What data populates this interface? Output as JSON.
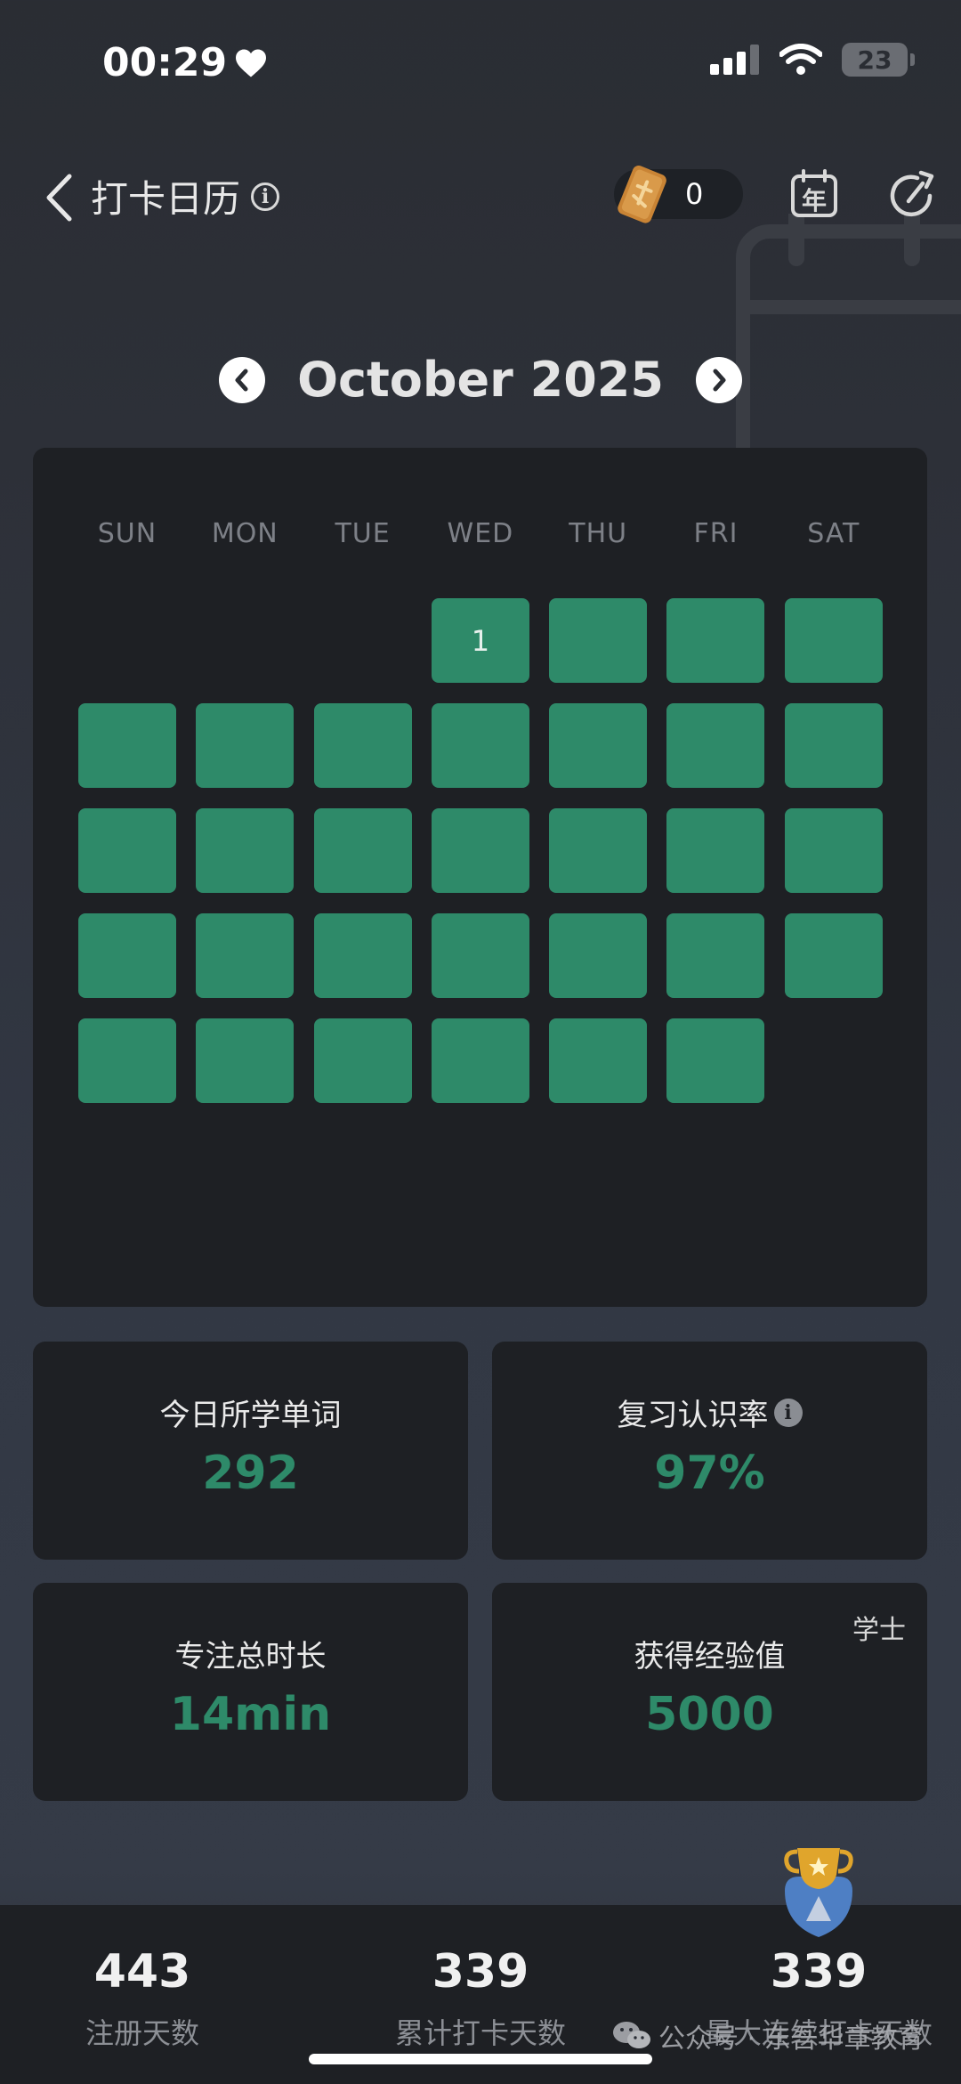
{
  "status_bar": {
    "time": "00:29",
    "battery": "23"
  },
  "header": {
    "title": "打卡日历",
    "coins": "0",
    "year_button": "年"
  },
  "calendar": {
    "month_label": "October 2025",
    "weekdays": [
      "SUN",
      "MON",
      "TUE",
      "WED",
      "THU",
      "FRI",
      "SAT"
    ],
    "first_day_label": "1",
    "cell_color": "#2e8a69"
  },
  "stats": [
    {
      "label": "今日所学单词",
      "value": "292"
    },
    {
      "label": "复习认识率",
      "value": "97%"
    },
    {
      "label": "专注总时长",
      "value": "14min"
    },
    {
      "label": "获得经验值",
      "value": "5000",
      "badge": "学士"
    }
  ],
  "summary": [
    {
      "value": "443",
      "label": "注册天数"
    },
    {
      "value": "339",
      "label": "累计打卡天数"
    },
    {
      "value": "339",
      "label": "最大连续打卡天数"
    }
  ],
  "watermark": "公众号 · 东吾华章教育",
  "accent_color": "#2e8a69"
}
